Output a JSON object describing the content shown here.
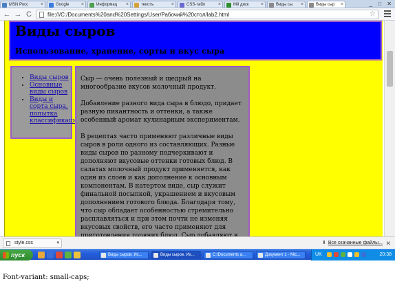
{
  "browser": {
    "tabs": [
      {
        "label": "MSN Росс",
        "color": "#4a7fc4"
      },
      {
        "label": "Google",
        "color": "#3a7be0"
      },
      {
        "label": "Информац",
        "color": "#4fa04f"
      },
      {
        "label": "текстъ",
        "color": "#d6a23a"
      },
      {
        "label": "CSS-табл",
        "color": "#6a6ad0"
      },
      {
        "label": "Мй диск",
        "color": "#2f8f2f"
      },
      {
        "label": "Виды сы",
        "color": "#8a8a8a"
      },
      {
        "label": "Виды сыр",
        "color": "#8a8a8a"
      }
    ],
    "window_controls": "_ □ ✕",
    "back_icon": "←",
    "forward_icon": "→",
    "reload_icon": "C",
    "url": "file:///C:/Documents%20and%20Settings/User/Рабочий%20стол/lab2.html",
    "star_icon": "☆"
  },
  "page": {
    "title": "Виды сыров",
    "subtitle": "Использование, хранение, сорты и вкус сыра",
    "nav_links": [
      "Виды сыров",
      "Основные виды сыров",
      "Виды и сорта сыра, попытка классификации"
    ],
    "paragraphs": [
      "Сыр — очень полезный и щедрый на многообразие вкусов молочный продукт.",
      "Добавление разного вида сыра в блюдо, придает разную пикантность и оттенки, а также особенный аромат кулинарным экспериментам.",
      "В рецептах часто применяют различные виды сыров в роли одного из составляющих. Разные виды сыров по разному подчеркивают и дополняют вкусовые оттенки готовых блюд. В салатах молочный продукт применяется, как один из слоев и как дополнение к основным компонентам. В натертом виде, сыр служит финальной посыпкой, украшением и вкусовым дополнением готового блюда. Благодаря тому, что сыр обладает особенностью стремительно расплавляться и при этом почти не изменяя вкусовых свойств, его часто применяют для приготовления горячих блюд. Сыр добавляют в супы, пиццу, мясо по-французски, и конечно же"
    ]
  },
  "downloads": {
    "file": "style.css",
    "caret": "▾",
    "all_label": "Все скачанные файлы...",
    "download_icon": "⬇",
    "close_icon": "✕"
  },
  "taskbar": {
    "start_label": "пуск",
    "quick_launch_colors": [
      "#e8a93a",
      "#3a6fd8",
      "#e04a3a",
      "#5fb33f",
      "#f0c23a"
    ],
    "tasks": [
      {
        "label": "Виды сыров. Их...",
        "active": false
      },
      {
        "label": "Виды сыров. Их...",
        "active": true
      },
      {
        "label": "C:\\Documents a...",
        "active": false
      },
      {
        "label": "Документ 1 - Mic...",
        "active": false
      }
    ],
    "language": "UK",
    "clock": "20:38"
  },
  "caption": "Font-variant: small-caps;"
}
